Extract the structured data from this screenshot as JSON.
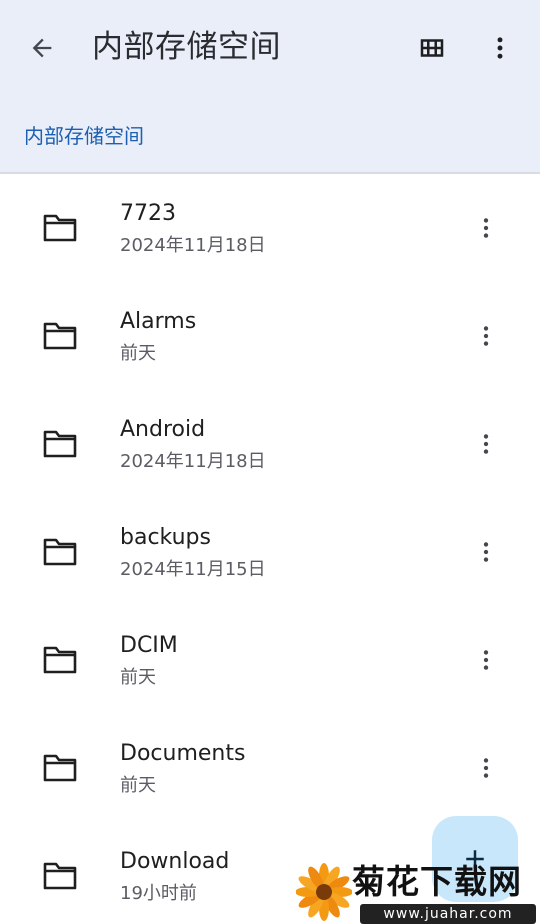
{
  "appbar": {
    "title": "内部存储空间",
    "back_icon": "arrow-back-icon",
    "grid_icon": "grid-view-icon",
    "menu_icon": "more-vert-icon"
  },
  "breadcrumb": {
    "label": "内部存储空间"
  },
  "colors": {
    "header_bg": "#e9eef9",
    "breadcrumb": "#1d5fb0",
    "fab_bg": "#c9e7fb"
  },
  "files": [
    {
      "name": "7723",
      "date": "2024年11月18日"
    },
    {
      "name": "Alarms",
      "date": "前天"
    },
    {
      "name": "Android",
      "date": "2024年11月18日"
    },
    {
      "name": "backups",
      "date": "2024年11月15日"
    },
    {
      "name": "DCIM",
      "date": "前天"
    },
    {
      "name": "Documents",
      "date": "前天"
    },
    {
      "name": "Download",
      "date": "19小时前"
    }
  ],
  "fab": {
    "icon": "plus-icon"
  },
  "watermark": {
    "text": "菊花下载网",
    "url": "www.juahar.com"
  }
}
